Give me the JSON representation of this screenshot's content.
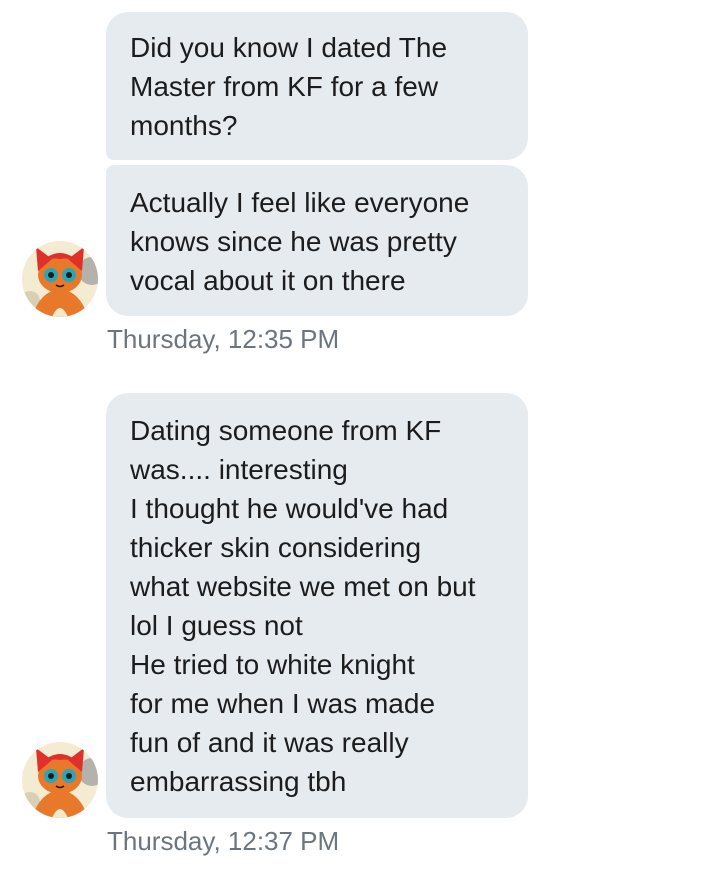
{
  "conversation": {
    "messages": [
      {
        "lines": [
          "Did you know I dated The",
          "Master from KF for a few",
          "months?"
        ]
      },
      {
        "lines": [
          "Actually I feel like everyone",
          "knows since he was pretty",
          "vocal about it on there"
        ]
      },
      {
        "lines": [
          "Dating someone from KF",
          "was.... interesting",
          "I thought he would've had",
          "thicker skin considering",
          "what website we met on but",
          "lol I guess not",
          "He tried to white knight",
          "for me when I was made",
          "fun of and it was really",
          "embarrassing tbh"
        ]
      }
    ],
    "timestamps": [
      "Thursday, 12:35 PM",
      "Thursday, 12:37 PM"
    ]
  },
  "avatar": {
    "icon": "cartoon-cat-avatar-icon",
    "colors": {
      "background": "#f3ecd2",
      "fur_orange": "#e8782a",
      "hair_red": "#e0302a",
      "eyes_teal": "#2aa6b8",
      "gray_rim": "#9a9a9a"
    }
  },
  "theme": {
    "bubble_color": "#e6ebf0",
    "text_color": "#1c1c1c",
    "timestamp_color": "#6b7580",
    "background": "#ffffff"
  }
}
